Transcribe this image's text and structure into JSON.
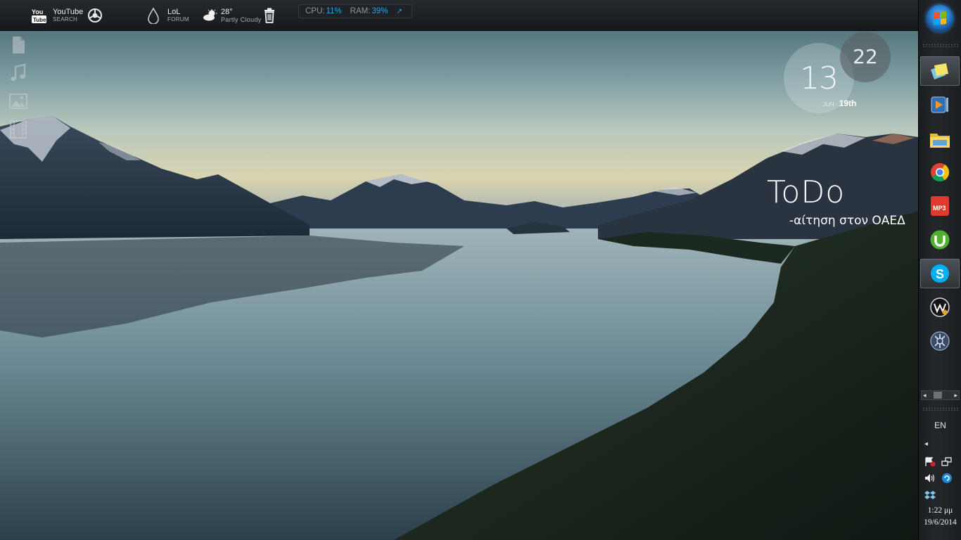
{
  "topbar": {
    "youtube": {
      "label": "YouTube",
      "sub": "SEARCH"
    },
    "lol": {
      "label": "LoL",
      "sub": "FORUM"
    },
    "weather": {
      "temp": "28°",
      "condition": "Partly Cloudy"
    },
    "stats": {
      "cpu_label": "CPU:",
      "cpu_value": "11%",
      "ram_label": "RAM:",
      "ram_value": "39%",
      "arrow": "↗"
    }
  },
  "side_icons": [
    "document-icon",
    "music-icon",
    "image-icon",
    "film-icon"
  ],
  "clock_widget": {
    "hour": "13",
    "minute": "22",
    "month": "JUN",
    "sep": "·",
    "day": "19th"
  },
  "todo": {
    "title": "ToDo",
    "items": [
      "-αίτηση στον ΟΑΕΔ"
    ]
  },
  "taskbar": {
    "apps": [
      "sticky-notes-icon",
      "media-player-icon",
      "explorer-icon",
      "chrome-icon",
      "mp3-icon",
      "utorrent-icon",
      "skype-icon",
      "winamp-icon",
      "settings-icon"
    ],
    "lang": "EN",
    "time": "1:22 μμ",
    "date": "19/6/2014"
  },
  "colors": {
    "accent": "#2aa6e8",
    "taskbar": "#1c1f22"
  }
}
